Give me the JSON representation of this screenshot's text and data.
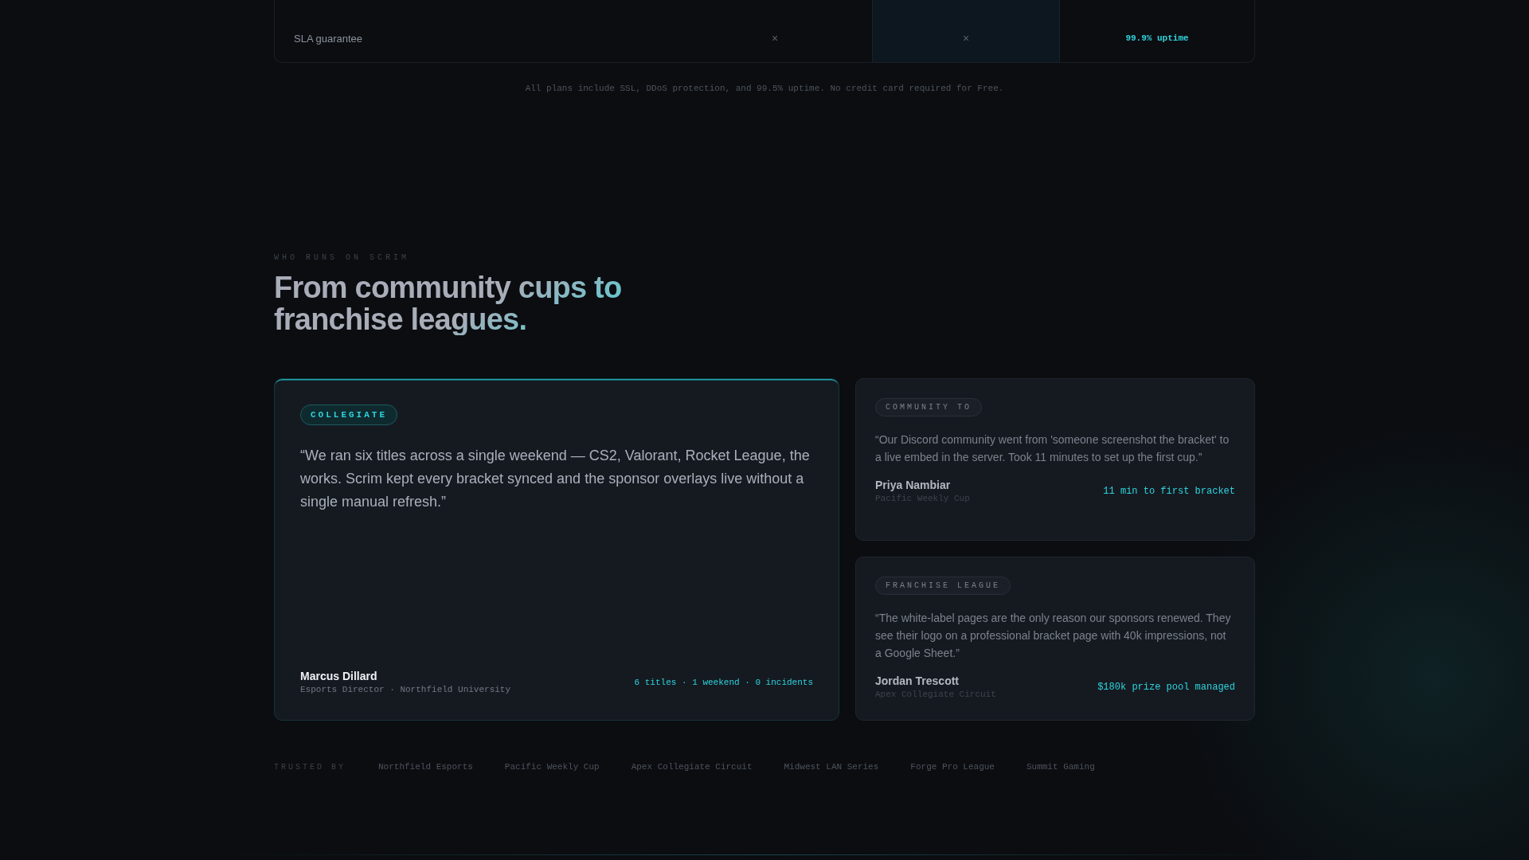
{
  "pricing_table": {
    "rows": [
      {
        "feature": "SLA guarantee",
        "cells": [
          {
            "kind": "cross",
            "symbol": "×",
            "highlighted": false
          },
          {
            "kind": "cross",
            "symbol": "×",
            "highlighted": true
          },
          {
            "kind": "text",
            "text": "99.9% uptime",
            "highlighted": false
          }
        ]
      }
    ]
  },
  "pricing_note": "All plans include SSL, DDoS protection, and 99.5% uptime. No credit card required for Free.",
  "testimonials": {
    "eyebrow": "WHO RUNS ON SCRIM",
    "heading": "From community cups to franchise leagues.",
    "cards": [
      {
        "tag": "COLLEGIATE",
        "featured": true,
        "quote": "“We ran six titles across a single weekend — CS2, Valorant, Rocket League, the works. Scrim kept every bracket synced and the sponsor overlays live without a single manual refresh.”",
        "name": "Marcus Dillard",
        "role": "Esports Director · Northfield University",
        "stat": "6 titles · 1 weekend · 0 incidents"
      },
      {
        "tag": "COMMUNITY TO",
        "featured": false,
        "quote": "“Our Discord community went from 'someone screenshot the bracket' to a live embed in the server. Took 11 minutes to set up the first cup.”",
        "name": "Priya Nambiar",
        "role": "Pacific Weekly Cup",
        "stat": "11 min to first bracket"
      },
      {
        "tag": "FRANCHISE LEAGUE",
        "featured": false,
        "quote": "“The white-label pages are the only reason our sponsors renewed. They see their logo on a professional bracket page with 40k impressions, not a Google Sheet.”",
        "name": "Jordan Trescott",
        "role": "Apex Collegiate Circuit",
        "stat": "$180k prize pool managed"
      }
    ]
  },
  "trusted_by": {
    "label": "TRUSTED BY",
    "names": [
      "Northfield Esports",
      "Pacific Weekly Cup",
      "Apex Collegiate Circuit",
      "Midwest LAN Series",
      "Forge Pro League",
      "Summit Gaming"
    ]
  }
}
